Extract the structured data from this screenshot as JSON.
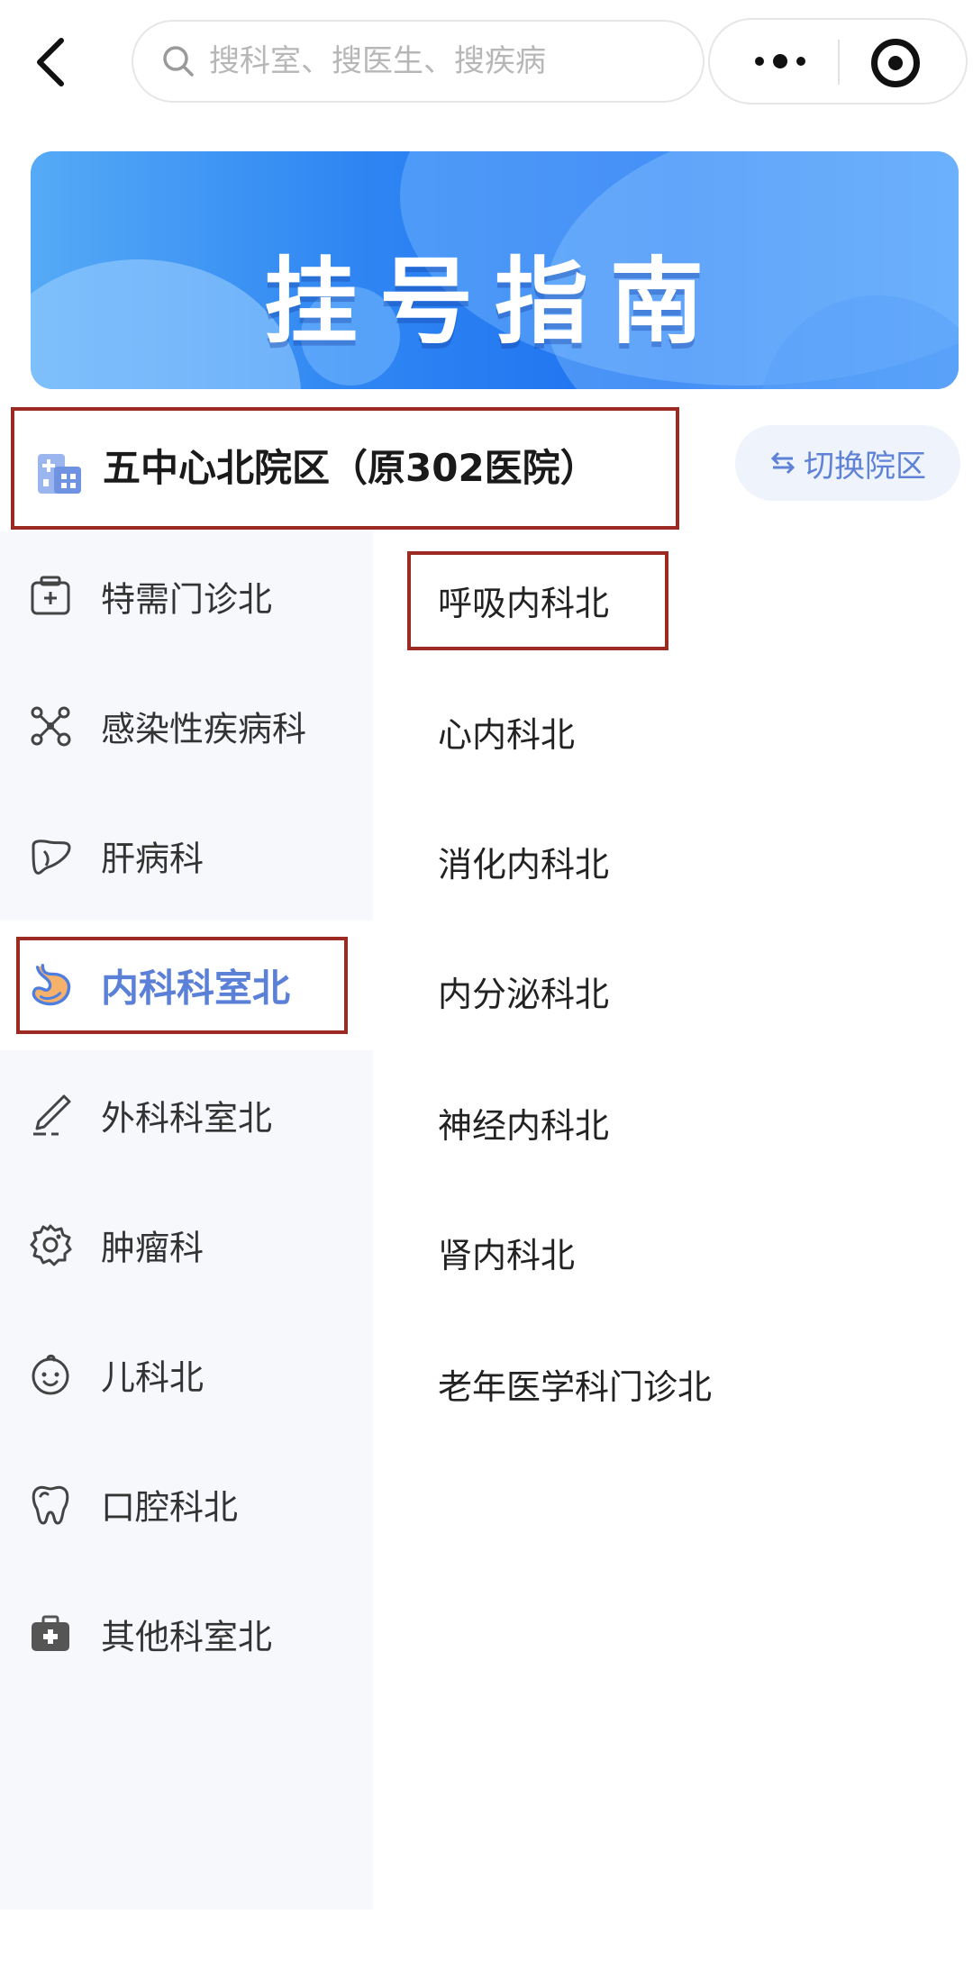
{
  "search": {
    "placeholder": "搜科室、搜医生、搜疾病"
  },
  "banner": {
    "title": "挂号指南"
  },
  "hospital": {
    "name": "五中心北院区（原302医院）",
    "switch_label": "切换院区"
  },
  "sidebar": {
    "items": [
      {
        "label": "特需门诊北",
        "icon": "clinic-box-icon"
      },
      {
        "label": "感染性疾病科",
        "icon": "molecule-icon"
      },
      {
        "label": "肝病科",
        "icon": "liver-icon"
      },
      {
        "label": "内科科室北",
        "icon": "stomach-icon",
        "active": true
      },
      {
        "label": "外科科室北",
        "icon": "scalpel-icon"
      },
      {
        "label": "肿瘤科",
        "icon": "tumor-cell-icon"
      },
      {
        "label": "儿科北",
        "icon": "baby-face-icon"
      },
      {
        "label": "口腔科北",
        "icon": "tooth-icon"
      },
      {
        "label": "其他科室北",
        "icon": "medical-kit-icon"
      }
    ]
  },
  "departments": {
    "items": [
      {
        "label": "呼吸内科北"
      },
      {
        "label": "心内科北"
      },
      {
        "label": "消化内科北"
      },
      {
        "label": "内分泌科北"
      },
      {
        "label": "神经内科北"
      },
      {
        "label": "肾内科北"
      },
      {
        "label": "老年医学科门诊北"
      }
    ]
  },
  "colors": {
    "accent": "#5a80d8",
    "highlight_box": "#9b2a22",
    "sidebar_bg": "#f6f8fc",
    "banner_blue": "#1c6ff0"
  }
}
